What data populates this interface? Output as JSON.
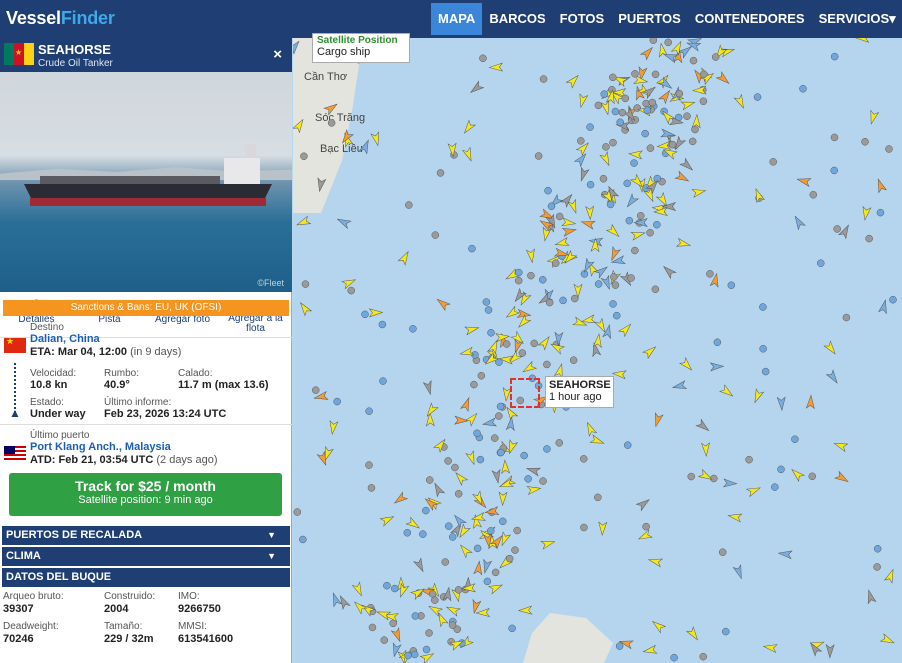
{
  "header": {
    "logo_a": "Vessel",
    "logo_b": "Finder",
    "nav": [
      "MAPA",
      "BARCOS",
      "FOTOS",
      "PUERTOS",
      "CONTENEDORES",
      "SERVICIOS▾"
    ]
  },
  "vessel": {
    "name": "SEAHORSE",
    "type": "Crude Oil Tanker",
    "close": "×",
    "sanctions": "Sanctions & Bans: EU, UK (OFSI)"
  },
  "actions": [
    {
      "label": "Detalles",
      "icon": "info-icon"
    },
    {
      "label": "Pista",
      "icon": "ship-icon"
    },
    {
      "label": "Agregar foto",
      "icon": "camera-icon"
    },
    {
      "label": "Agregar a la flota",
      "icon": "star-icon"
    }
  ],
  "voyage": {
    "dest_label": "Destino",
    "dest_value": "Dalian, China",
    "eta_label": "ETA:",
    "eta_value": "Mar 04, 12:00",
    "eta_rel": "(in 9 days)",
    "speed_label": "Velocidad:",
    "speed_value": "10.8 kn",
    "course_label": "Rumbo:",
    "course_value": "40.9°",
    "draft_label": "Calado:",
    "draft_value": "11.7 m",
    "draft_max": "(max 13.6)",
    "status_label": "Estado:",
    "status_value": "Under way",
    "report_label": "Último informe:",
    "report_value": "Feb 23, 2026 13:24 UTC",
    "lastport_label": "Último puerto",
    "lastport_value": "Port Klang Anch., Malaysia",
    "atd_label": "ATD:",
    "atd_value": "Feb 21, 03:54 UTC",
    "atd_rel": "(2 days ago)"
  },
  "track": {
    "title": "Track for $25 / month",
    "subtitle": "Satellite position: 9 min ago"
  },
  "sections": [
    "PUERTOS DE RECALADA",
    "CLIMA",
    "DATOS DEL BUQUE"
  ],
  "ship_data": {
    "gt_label": "Arqueo bruto:",
    "gt_value": "39307",
    "built_label": "Construido:",
    "built_value": "2004",
    "imo_label": "IMO:",
    "imo_value": "9266750",
    "dwt_label": "Deadweight:",
    "dwt_value": "70246",
    "size_label": "Tamaño:",
    "size_value": "229 / 32m",
    "mmsi_label": "MMSI:",
    "mmsi_value": "613541600"
  },
  "map": {
    "places": [
      "Cần Thơ",
      "Sóc Trăng",
      "Bạc Liêu"
    ],
    "top_popup_title": "Satellite Position",
    "top_popup_sub": "Cargo ship",
    "tooltip_name": "SEAHORSE",
    "tooltip_time": "1 hour ago"
  },
  "photo_watermark": "©Fleet"
}
